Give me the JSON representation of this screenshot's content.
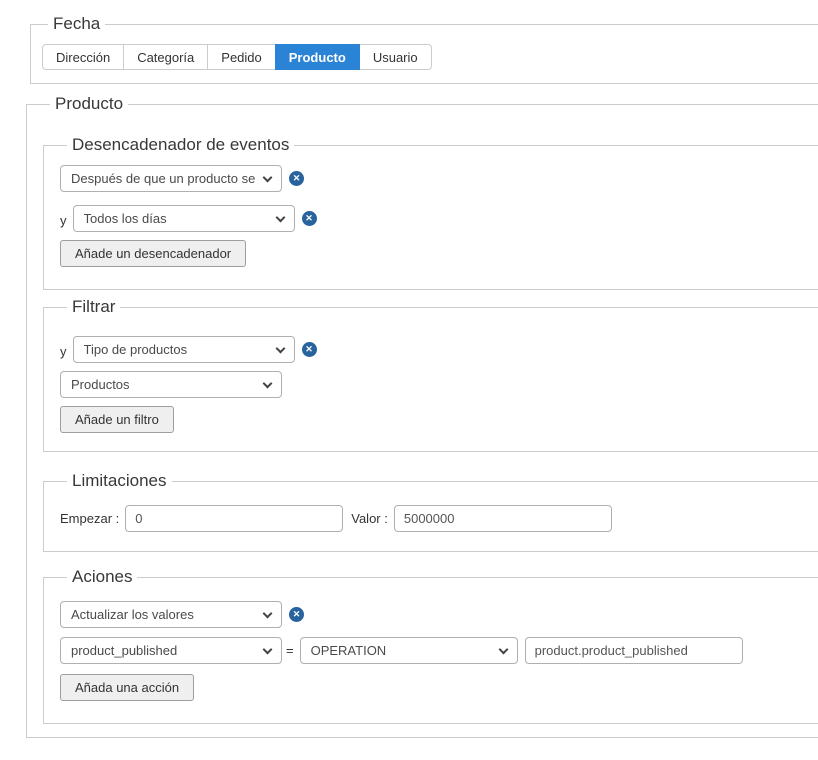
{
  "colors": {
    "active_tab_blue": "#2b83d5",
    "remove_icon_blue": "#28639e"
  },
  "icons": {
    "remove_glyph": "✕"
  },
  "fecha": {
    "legend": "Fecha",
    "tabs": [
      {
        "label": "Dirección",
        "active": false
      },
      {
        "label": "Categoría",
        "active": false
      },
      {
        "label": "Pedido",
        "active": false
      },
      {
        "label": "Producto",
        "active": true
      },
      {
        "label": "Usuario",
        "active": false
      }
    ]
  },
  "producto": {
    "legend": "Producto",
    "triggers": {
      "legend": "Desencadenador de eventos",
      "event_select_value": "Después de que un producto se",
      "and_label": "y",
      "schedule_select_value": "Todos los días",
      "add_button_label": "Añade un desencadenador"
    },
    "filters": {
      "legend": "Filtrar",
      "and_label": "y",
      "type_select_value": "Tipo de productos",
      "target_select_value": "Productos",
      "add_button_label": "Añade un filtro"
    },
    "limits": {
      "legend": "Limitaciones",
      "start_label": "Empezar :",
      "start_value": "0",
      "value_label": "Valor :",
      "value_value": "5000000"
    },
    "actions": {
      "legend": "Aciones",
      "action_select_value": "Actualizar los valores",
      "field_select_value": "product_published",
      "equals_label": "=",
      "operation_select_value": "OPERATION",
      "value_input_value": "product.product_published",
      "add_button_label": "Añada una acción"
    }
  }
}
